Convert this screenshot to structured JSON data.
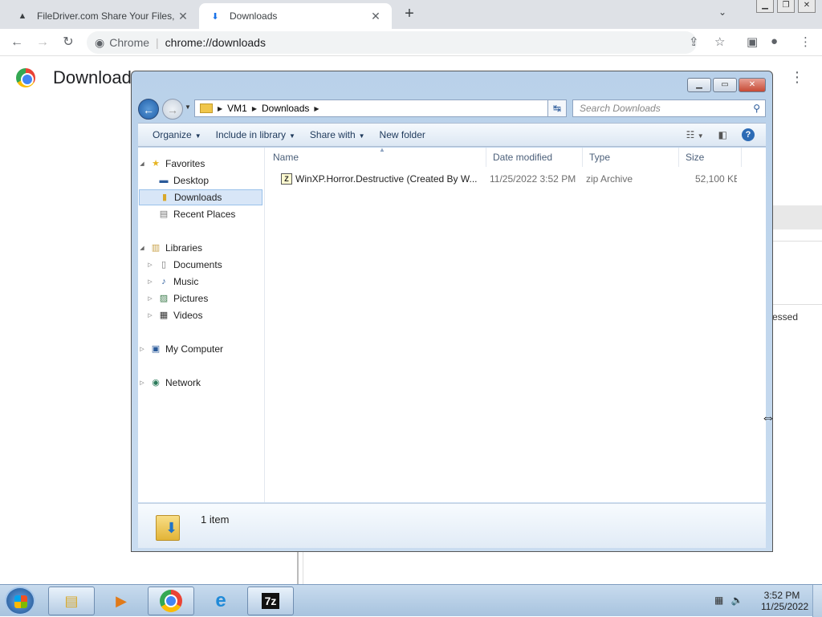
{
  "browser": {
    "tabs": [
      {
        "title": "FileDriver.com Share Your Files, G",
        "icon": "triangle-icon"
      },
      {
        "title": "Downloads",
        "icon": "download-icon"
      }
    ],
    "new_tab": "+",
    "site_name": "Chrome",
    "url": "chrome://downloads",
    "page_title": "Download",
    "bg_text": "essed"
  },
  "explorer": {
    "breadcrumb": [
      "VM1",
      "Downloads"
    ],
    "search_placeholder": "Search Downloads",
    "commands": {
      "organize": "Organize",
      "include": "Include in library",
      "share": "Share with",
      "new_folder": "New folder"
    },
    "nav": {
      "favorites": "Favorites",
      "desktop": "Desktop",
      "downloads": "Downloads",
      "recent": "Recent Places",
      "libraries": "Libraries",
      "documents": "Documents",
      "music": "Music",
      "pictures": "Pictures",
      "videos": "Videos",
      "computer": "My Computer",
      "network": "Network"
    },
    "columns": {
      "name": "Name",
      "date": "Date modified",
      "type": "Type",
      "size": "Size"
    },
    "files": [
      {
        "name": "WinXP.Horror.Destructive  (Created By W...",
        "date": "11/25/2022 3:52 PM",
        "type": "zip Archive",
        "size": "52,100 KB"
      }
    ],
    "item_count": "1 item"
  },
  "taskbar": {
    "time": "3:52 PM",
    "date": "11/25/2022",
    "apps": [
      "explorer",
      "media-player",
      "chrome",
      "internet-explorer",
      "7zip"
    ]
  },
  "colors": {
    "accent": "#1f5ea8",
    "chrome_tabstrip": "#dee1e6",
    "selection": "#d8e6f7"
  }
}
